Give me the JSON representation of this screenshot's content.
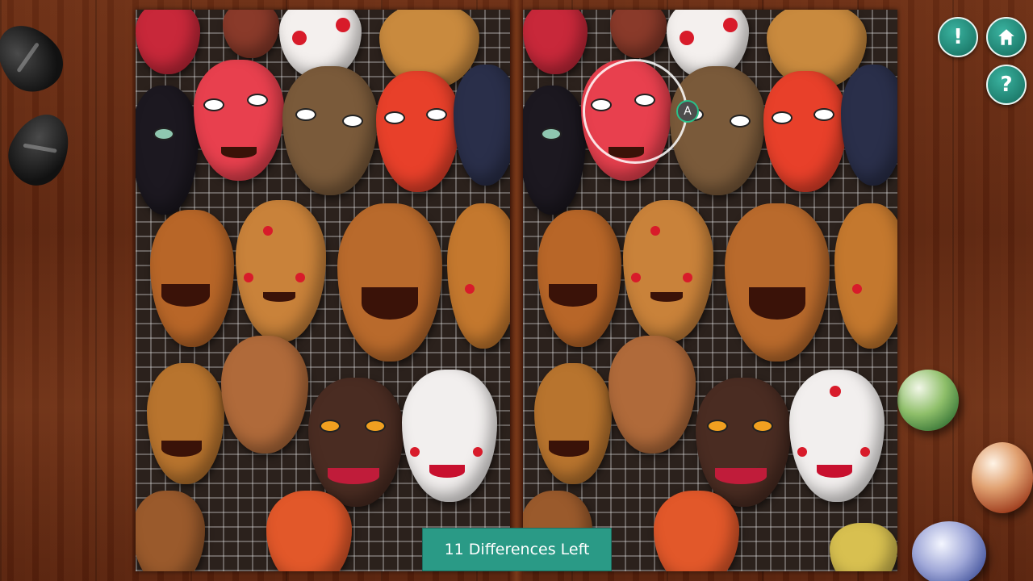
{
  "game": {
    "differences_left_text": "11 Differences Left",
    "hint_marker_label": "A",
    "accent_color": "#2a9a86"
  },
  "buttons": {
    "alert_glyph": "!",
    "help_glyph": "?",
    "home_icon": "home-icon"
  },
  "scene": {
    "left_image": "korean-masks-photo",
    "right_image": "korean-masks-photo-modified"
  }
}
